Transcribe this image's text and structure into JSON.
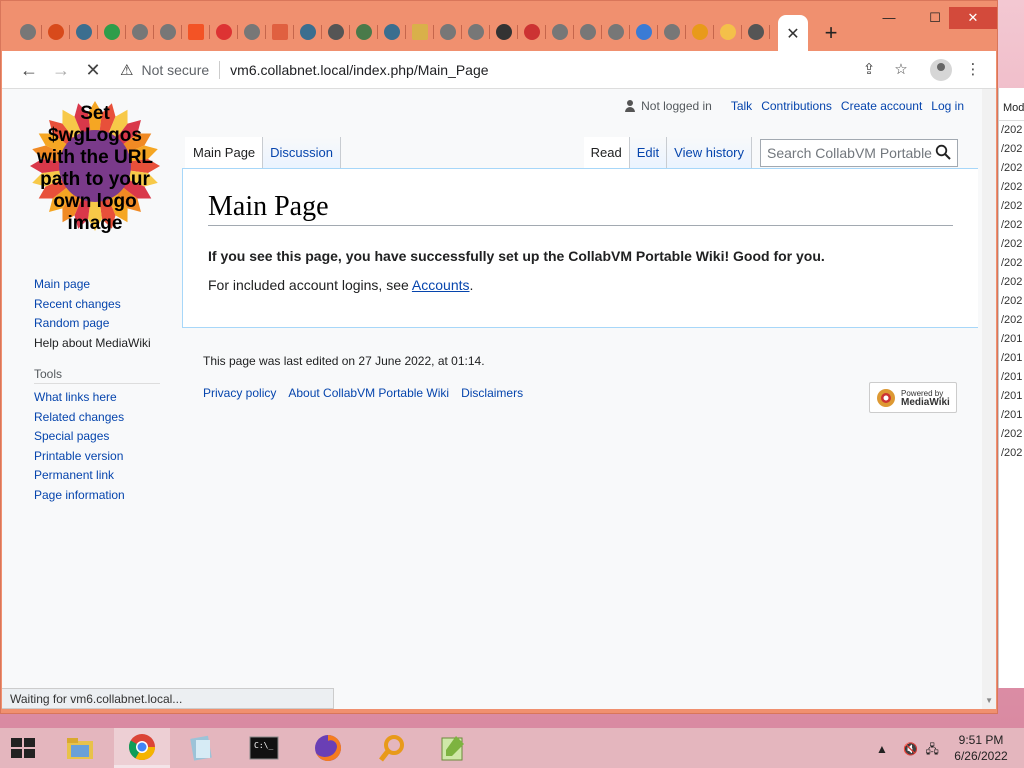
{
  "browser": {
    "active_tab_close": "✕",
    "new_tab": "+",
    "window_controls": {
      "minimize": "—",
      "maximize": "☐",
      "close": "✕"
    },
    "omnibox": {
      "security": "Not secure",
      "url": "vm6.collabnet.local/index.php/Main_Page"
    },
    "status": "Waiting for vm6.collabnet.local..."
  },
  "wiki": {
    "logo_lines": [
      "Set",
      "$wgLogos",
      "with the URL",
      "path to your",
      "own logo",
      "image"
    ],
    "personal": {
      "not_logged_in": "Not logged in",
      "links": [
        "Talk",
        "Contributions",
        "Create account",
        "Log in"
      ]
    },
    "tabs_left": [
      "Main Page",
      "Discussion"
    ],
    "tabs_right": [
      "Read",
      "Edit",
      "View history"
    ],
    "search_placeholder": "Search CollabVM Portable Wiki",
    "title": "Main Page",
    "bold_line": "If you see this page, you have successfully set up the CollabVM Portable Wiki! Good for you.",
    "accounts_prefix": "For included account logins, see ",
    "accounts_link": "Accounts",
    "accounts_suffix": ".",
    "nav": [
      "Main page",
      "Recent changes",
      "Random page",
      "Help about MediaWiki"
    ],
    "tools_heading": "Tools",
    "tools": [
      "What links here",
      "Related changes",
      "Special pages",
      "Printable version",
      "Permanent link",
      "Page information"
    ],
    "last_edited": "This page was last edited on 27 June 2022, at 01:14.",
    "footer_links": [
      "Privacy policy",
      "About CollabVM Portable Wiki",
      "Disclaimers"
    ],
    "powered_small": "Powered by",
    "powered_big": "MediaWiki"
  },
  "bg_window": {
    "header": "Mod",
    "rows": [
      "/202",
      "/202",
      "/202",
      "/202",
      "/202",
      "/202",
      "/202",
      "/202",
      "/202",
      "/202",
      "/202",
      "/201",
      "/201",
      "/201",
      "/201",
      "/201",
      "/202",
      "/202"
    ]
  },
  "taskbar": {
    "clock_time": "9:51 PM",
    "clock_date": "6/26/2022"
  },
  "colors": {
    "link": "#0645ad",
    "browser_frame": "#f0906f",
    "close": "#d34a3b"
  }
}
